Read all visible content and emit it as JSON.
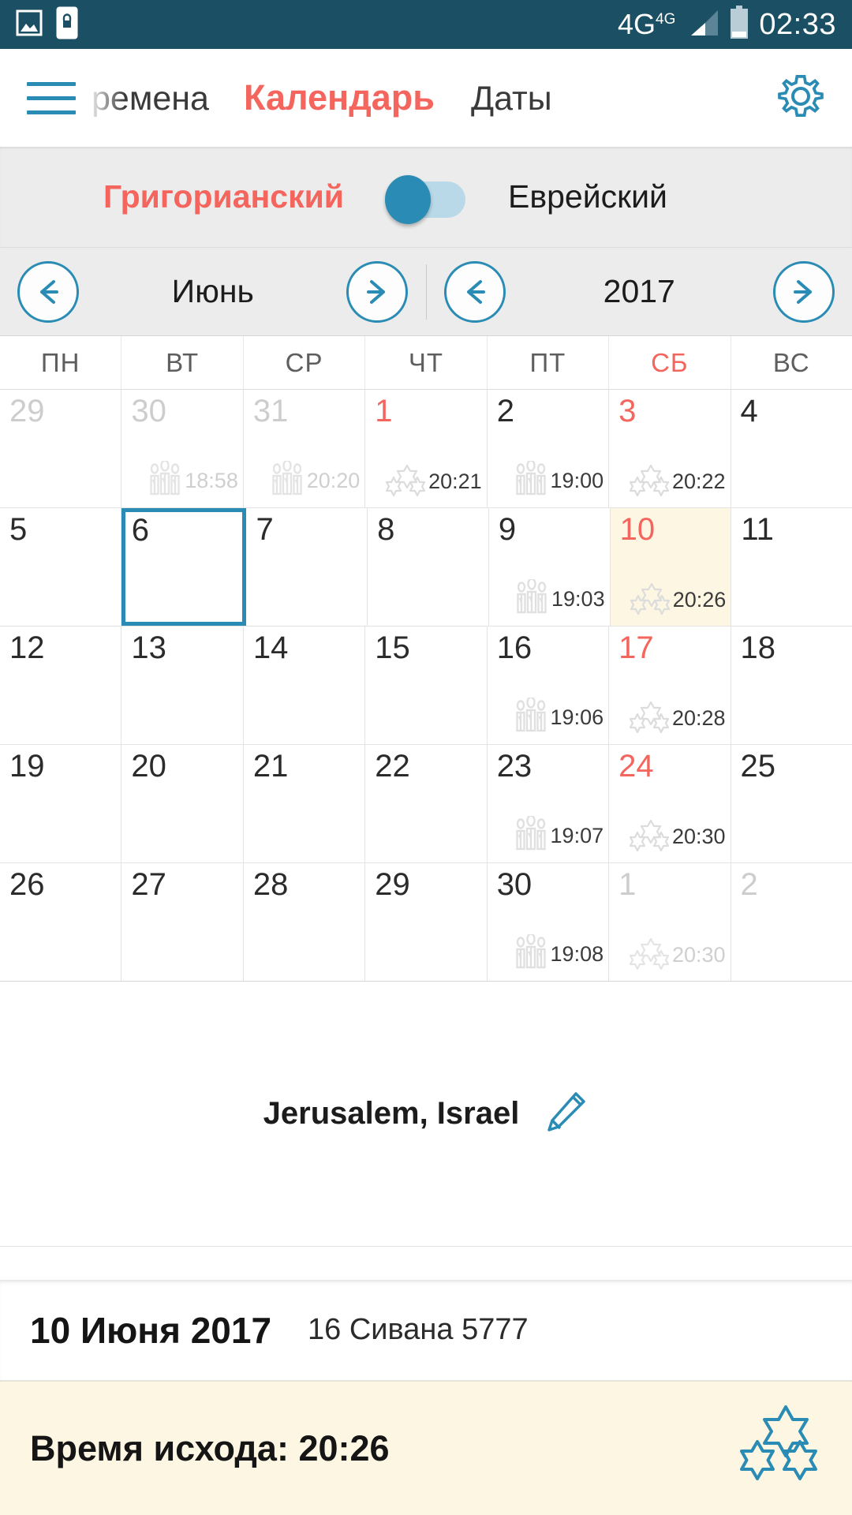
{
  "statusbar": {
    "icons": [
      "image-icon",
      "phone-lock-icon"
    ],
    "network": "4G",
    "network_sup": "4G",
    "signal": "signal-bars-icon",
    "battery": "battery-icon",
    "clock": "02:33"
  },
  "header": {
    "menu_icon": "hamburger-icon",
    "tab_prev": "ремена",
    "tab_active": "Календарь",
    "tab_next": "Даты",
    "settings_icon": "gear-icon"
  },
  "calendar_toggle": {
    "left_label": "Григорианский",
    "right_label": "Еврейский",
    "selected": "Григорианский",
    "active_color": "#f4655e",
    "thumb_color": "#2a8cb4",
    "track_color": "#b9d9e8"
  },
  "nav": {
    "month_prev": "prev-arrow-icon",
    "month": "Июнь",
    "month_next": "next-arrow-icon",
    "year_prev": "prev-arrow-icon",
    "year": "2017",
    "year_next": "next-arrow-icon"
  },
  "weekdays": [
    {
      "label": "ПН",
      "weekend": false
    },
    {
      "label": "ВТ",
      "weekend": false
    },
    {
      "label": "СР",
      "weekend": false
    },
    {
      "label": "ЧТ",
      "weekend": false
    },
    {
      "label": "ПТ",
      "weekend": false
    },
    {
      "label": "СБ",
      "weekend": true
    },
    {
      "label": "ВС",
      "weekend": false
    }
  ],
  "weeks": [
    [
      {
        "day": "29",
        "muted": true,
        "red": false,
        "event": null
      },
      {
        "day": "30",
        "muted": true,
        "red": false,
        "event": {
          "icon": "candles-icon",
          "time": "18:58",
          "dim": true
        }
      },
      {
        "day": "31",
        "muted": true,
        "red": false,
        "event": {
          "icon": "candles-icon",
          "time": "20:20",
          "dim": true
        }
      },
      {
        "day": "1",
        "muted": false,
        "red": true,
        "event": {
          "icon": "stars-icon",
          "time": "20:21",
          "dim": false
        }
      },
      {
        "day": "2",
        "muted": false,
        "red": false,
        "event": {
          "icon": "candles-icon",
          "time": "19:00",
          "dim": false
        }
      },
      {
        "day": "3",
        "muted": false,
        "red": true,
        "event": {
          "icon": "stars-icon",
          "time": "20:22",
          "dim": false
        }
      },
      {
        "day": "4",
        "muted": false,
        "red": false,
        "event": null
      }
    ],
    [
      {
        "day": "5",
        "muted": false,
        "red": false,
        "event": null
      },
      {
        "day": "6",
        "muted": false,
        "red": false,
        "today": true,
        "event": null
      },
      {
        "day": "7",
        "muted": false,
        "red": false,
        "event": null
      },
      {
        "day": "8",
        "muted": false,
        "red": false,
        "event": null
      },
      {
        "day": "9",
        "muted": false,
        "red": false,
        "event": {
          "icon": "candles-icon",
          "time": "19:03",
          "dim": false
        }
      },
      {
        "day": "10",
        "muted": false,
        "red": true,
        "selected": true,
        "event": {
          "icon": "stars-icon",
          "time": "20:26",
          "dim": false
        }
      },
      {
        "day": "11",
        "muted": false,
        "red": false,
        "event": null
      }
    ],
    [
      {
        "day": "12",
        "muted": false,
        "red": false,
        "event": null
      },
      {
        "day": "13",
        "muted": false,
        "red": false,
        "event": null
      },
      {
        "day": "14",
        "muted": false,
        "red": false,
        "event": null
      },
      {
        "day": "15",
        "muted": false,
        "red": false,
        "event": null
      },
      {
        "day": "16",
        "muted": false,
        "red": false,
        "event": {
          "icon": "candles-icon",
          "time": "19:06",
          "dim": false
        }
      },
      {
        "day": "17",
        "muted": false,
        "red": true,
        "event": {
          "icon": "stars-icon",
          "time": "20:28",
          "dim": false
        }
      },
      {
        "day": "18",
        "muted": false,
        "red": false,
        "event": null
      }
    ],
    [
      {
        "day": "19",
        "muted": false,
        "red": false,
        "event": null
      },
      {
        "day": "20",
        "muted": false,
        "red": false,
        "event": null
      },
      {
        "day": "21",
        "muted": false,
        "red": false,
        "event": null
      },
      {
        "day": "22",
        "muted": false,
        "red": false,
        "event": null
      },
      {
        "day": "23",
        "muted": false,
        "red": false,
        "event": {
          "icon": "candles-icon",
          "time": "19:07",
          "dim": false
        }
      },
      {
        "day": "24",
        "muted": false,
        "red": true,
        "event": {
          "icon": "stars-icon",
          "time": "20:30",
          "dim": false
        }
      },
      {
        "day": "25",
        "muted": false,
        "red": false,
        "event": null
      }
    ],
    [
      {
        "day": "26",
        "muted": false,
        "red": false,
        "event": null
      },
      {
        "day": "27",
        "muted": false,
        "red": false,
        "event": null
      },
      {
        "day": "28",
        "muted": false,
        "red": false,
        "event": null
      },
      {
        "day": "29",
        "muted": false,
        "red": false,
        "event": null
      },
      {
        "day": "30",
        "muted": false,
        "red": false,
        "event": {
          "icon": "candles-icon",
          "time": "19:08",
          "dim": false
        }
      },
      {
        "day": "1",
        "muted": true,
        "red": false,
        "event": {
          "icon": "stars-icon",
          "time": "20:30",
          "dim": true
        }
      },
      {
        "day": "2",
        "muted": true,
        "red": false,
        "event": null
      }
    ]
  ],
  "location": {
    "name": "Jerusalem, Israel",
    "edit_icon": "pencil-icon"
  },
  "selected_date": {
    "gregorian": "10 Июня 2017",
    "hebrew": "16 Сивана 5777"
  },
  "banner": {
    "text": "Время исхода: 20:26",
    "icon": "stars-icon",
    "background": "#fdf6e2",
    "icon_color": "#2a8cb4"
  }
}
